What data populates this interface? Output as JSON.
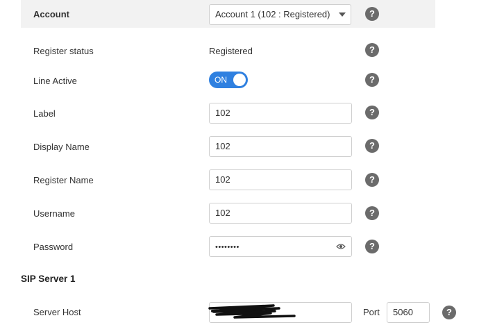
{
  "account": {
    "label": "Account",
    "selected": "Account 1 (102 : Registered)"
  },
  "help_glyph": "?",
  "fields": {
    "register_status": {
      "label": "Register status",
      "value": "Registered"
    },
    "line_active": {
      "label": "Line Active",
      "toggle_text": "ON",
      "state": true
    },
    "label": {
      "label": "Label",
      "value": "102"
    },
    "display_name": {
      "label": "Display Name",
      "value": "102"
    },
    "register_name": {
      "label": "Register Name",
      "value": "102"
    },
    "username": {
      "label": "Username",
      "value": "102"
    },
    "password": {
      "label": "Password",
      "masked_value": "••••••••"
    }
  },
  "sip_server": {
    "title": "SIP Server 1",
    "host_label": "Server Host",
    "port_label": "Port",
    "port_value": "5060"
  },
  "colors": {
    "toggle_on": "#2f80e0",
    "help_icon": "#6b6b6b",
    "header_bg": "#f2f2f2"
  }
}
